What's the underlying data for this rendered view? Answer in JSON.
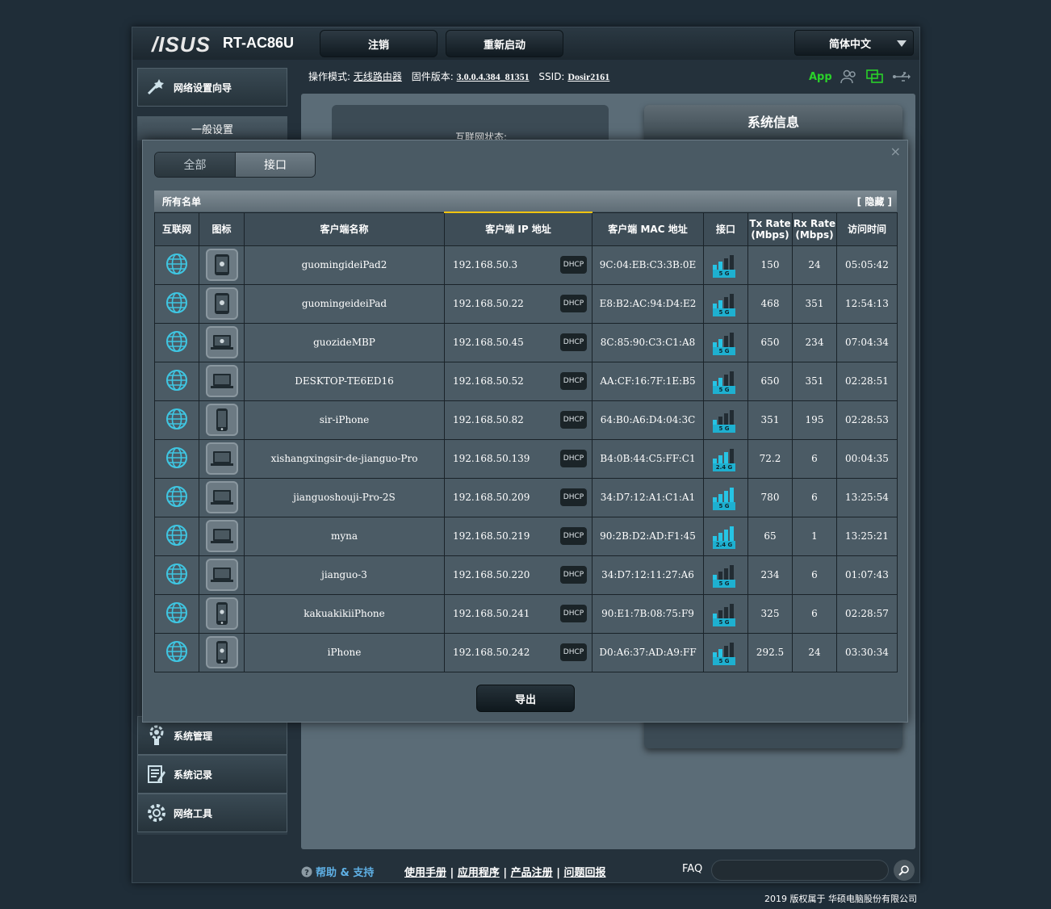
{
  "header": {
    "logo": "/ISUS",
    "model": "RT-AC86U",
    "logout_label": "注销",
    "reboot_label": "重新启动",
    "language": "简体中文"
  },
  "status": {
    "mode_label": "操作模式:",
    "mode_value": "无线路由器",
    "fw_label": "固件版本:",
    "fw_value": "3.0.0.4.384_81351",
    "ssid_label": "SSID:",
    "ssid_value": "Dosir2161",
    "app_label": "App"
  },
  "sidebar": {
    "wizard_label": "网络设置向导",
    "general_label": "一般设置",
    "items": [
      {
        "label": "系统管理",
        "icon": "gear-admin-icon"
      },
      {
        "label": "系统记录",
        "icon": "log-icon"
      },
      {
        "label": "网络工具",
        "icon": "tools-icon"
      }
    ]
  },
  "main": {
    "internet_status_label": "互联网状态:",
    "sysinfo_title": "系统信息"
  },
  "modal": {
    "close_label": "×",
    "tabs": [
      "全部",
      "接口"
    ],
    "list_title": "所有名单",
    "hide_label": "[ 隐藏 ]",
    "columns": [
      "互联网",
      "图标",
      "客户端名称",
      "客户端 IP 地址",
      "客户端 MAC 地址",
      "接口",
      "Tx Rate (Mbps)",
      "Rx Rate (Mbps)",
      "访问时间"
    ],
    "dhcp_label": "DHCP",
    "export_label": "导出",
    "clients": [
      {
        "name": "guomingideiPad2",
        "ip": "192.168.50.3",
        "mac": "9C:04:EB:C3:3B:0E",
        "band": "5 G",
        "bars": 2,
        "tx": "150",
        "rx": "24",
        "time": "05:05:42",
        "device": "tablet"
      },
      {
        "name": "guomingeideiPad",
        "ip": "192.168.50.22",
        "mac": "E8:B2:AC:94:D4:E2",
        "band": "5 G",
        "bars": 2,
        "tx": "468",
        "rx": "351",
        "time": "12:54:13",
        "device": "tablet"
      },
      {
        "name": "guozideMBP",
        "ip": "192.168.50.45",
        "mac": "8C:85:90:C3:C1:A8",
        "band": "5 G",
        "bars": 2,
        "tx": "650",
        "rx": "234",
        "time": "07:04:34",
        "device": "macbook"
      },
      {
        "name": "DESKTOP-TE6ED16",
        "ip": "192.168.50.52",
        "mac": "AA:CF:16:7F:1E:B5",
        "band": "5 G",
        "bars": 2,
        "tx": "650",
        "rx": "351",
        "time": "02:28:51",
        "device": "laptop"
      },
      {
        "name": "sir-iPhone",
        "ip": "192.168.50.82",
        "mac": "64:B0:A6:D4:04:3C",
        "band": "5 G",
        "bars": 1,
        "tx": "351",
        "rx": "195",
        "time": "02:28:53",
        "device": "phone"
      },
      {
        "name": "xishangxingsir-de-jianguo-Pro",
        "ip": "192.168.50.139",
        "mac": "B4:0B:44:C5:FF:C1",
        "band": "2.4 G",
        "bars": 3,
        "tx": "72.2",
        "rx": "6",
        "time": "00:04:35",
        "device": "laptop"
      },
      {
        "name": "jianguoshouji-Pro-2S",
        "ip": "192.168.50.209",
        "mac": "34:D7:12:A1:C1:A1",
        "band": "5 G",
        "bars": 4,
        "tx": "780",
        "rx": "6",
        "time": "13:25:54",
        "device": "laptop"
      },
      {
        "name": "myna",
        "ip": "192.168.50.219",
        "mac": "90:2B:D2:AD:F1:45",
        "band": "2.4 G",
        "bars": 4,
        "tx": "65",
        "rx": "1",
        "time": "13:25:21",
        "device": "laptop"
      },
      {
        "name": "jianguo-3",
        "ip": "192.168.50.220",
        "mac": "34:D7:12:11:27:A6",
        "band": "5 G",
        "bars": 1,
        "tx": "234",
        "rx": "6",
        "time": "01:07:43",
        "device": "laptop"
      },
      {
        "name": "kakuakikiiPhone",
        "ip": "192.168.50.241",
        "mac": "90:E1:7B:08:75:F9",
        "band": "5 G",
        "bars": 1,
        "tx": "325",
        "rx": "6",
        "time": "02:28:57",
        "device": "iphone"
      },
      {
        "name": "iPhone",
        "ip": "192.168.50.242",
        "mac": "D0:A6:37:AD:A9:FF",
        "band": "5 G",
        "bars": 2,
        "tx": "292.5",
        "rx": "24",
        "time": "03:30:34",
        "device": "iphone"
      }
    ]
  },
  "footer": {
    "help_label": "帮助 & 支持",
    "links": [
      "使用手册",
      "应用程序",
      "产品注册",
      "问题回报"
    ],
    "faq_label": "FAQ",
    "copyright": "2019 版权属于 华硕电脑股份有限公司"
  },
  "colors": {
    "accent_cyan": "#26c4e5",
    "app_green": "#2ad12a",
    "help_blue": "#5fb1e6",
    "sort_yellow": "#f1c40f"
  }
}
